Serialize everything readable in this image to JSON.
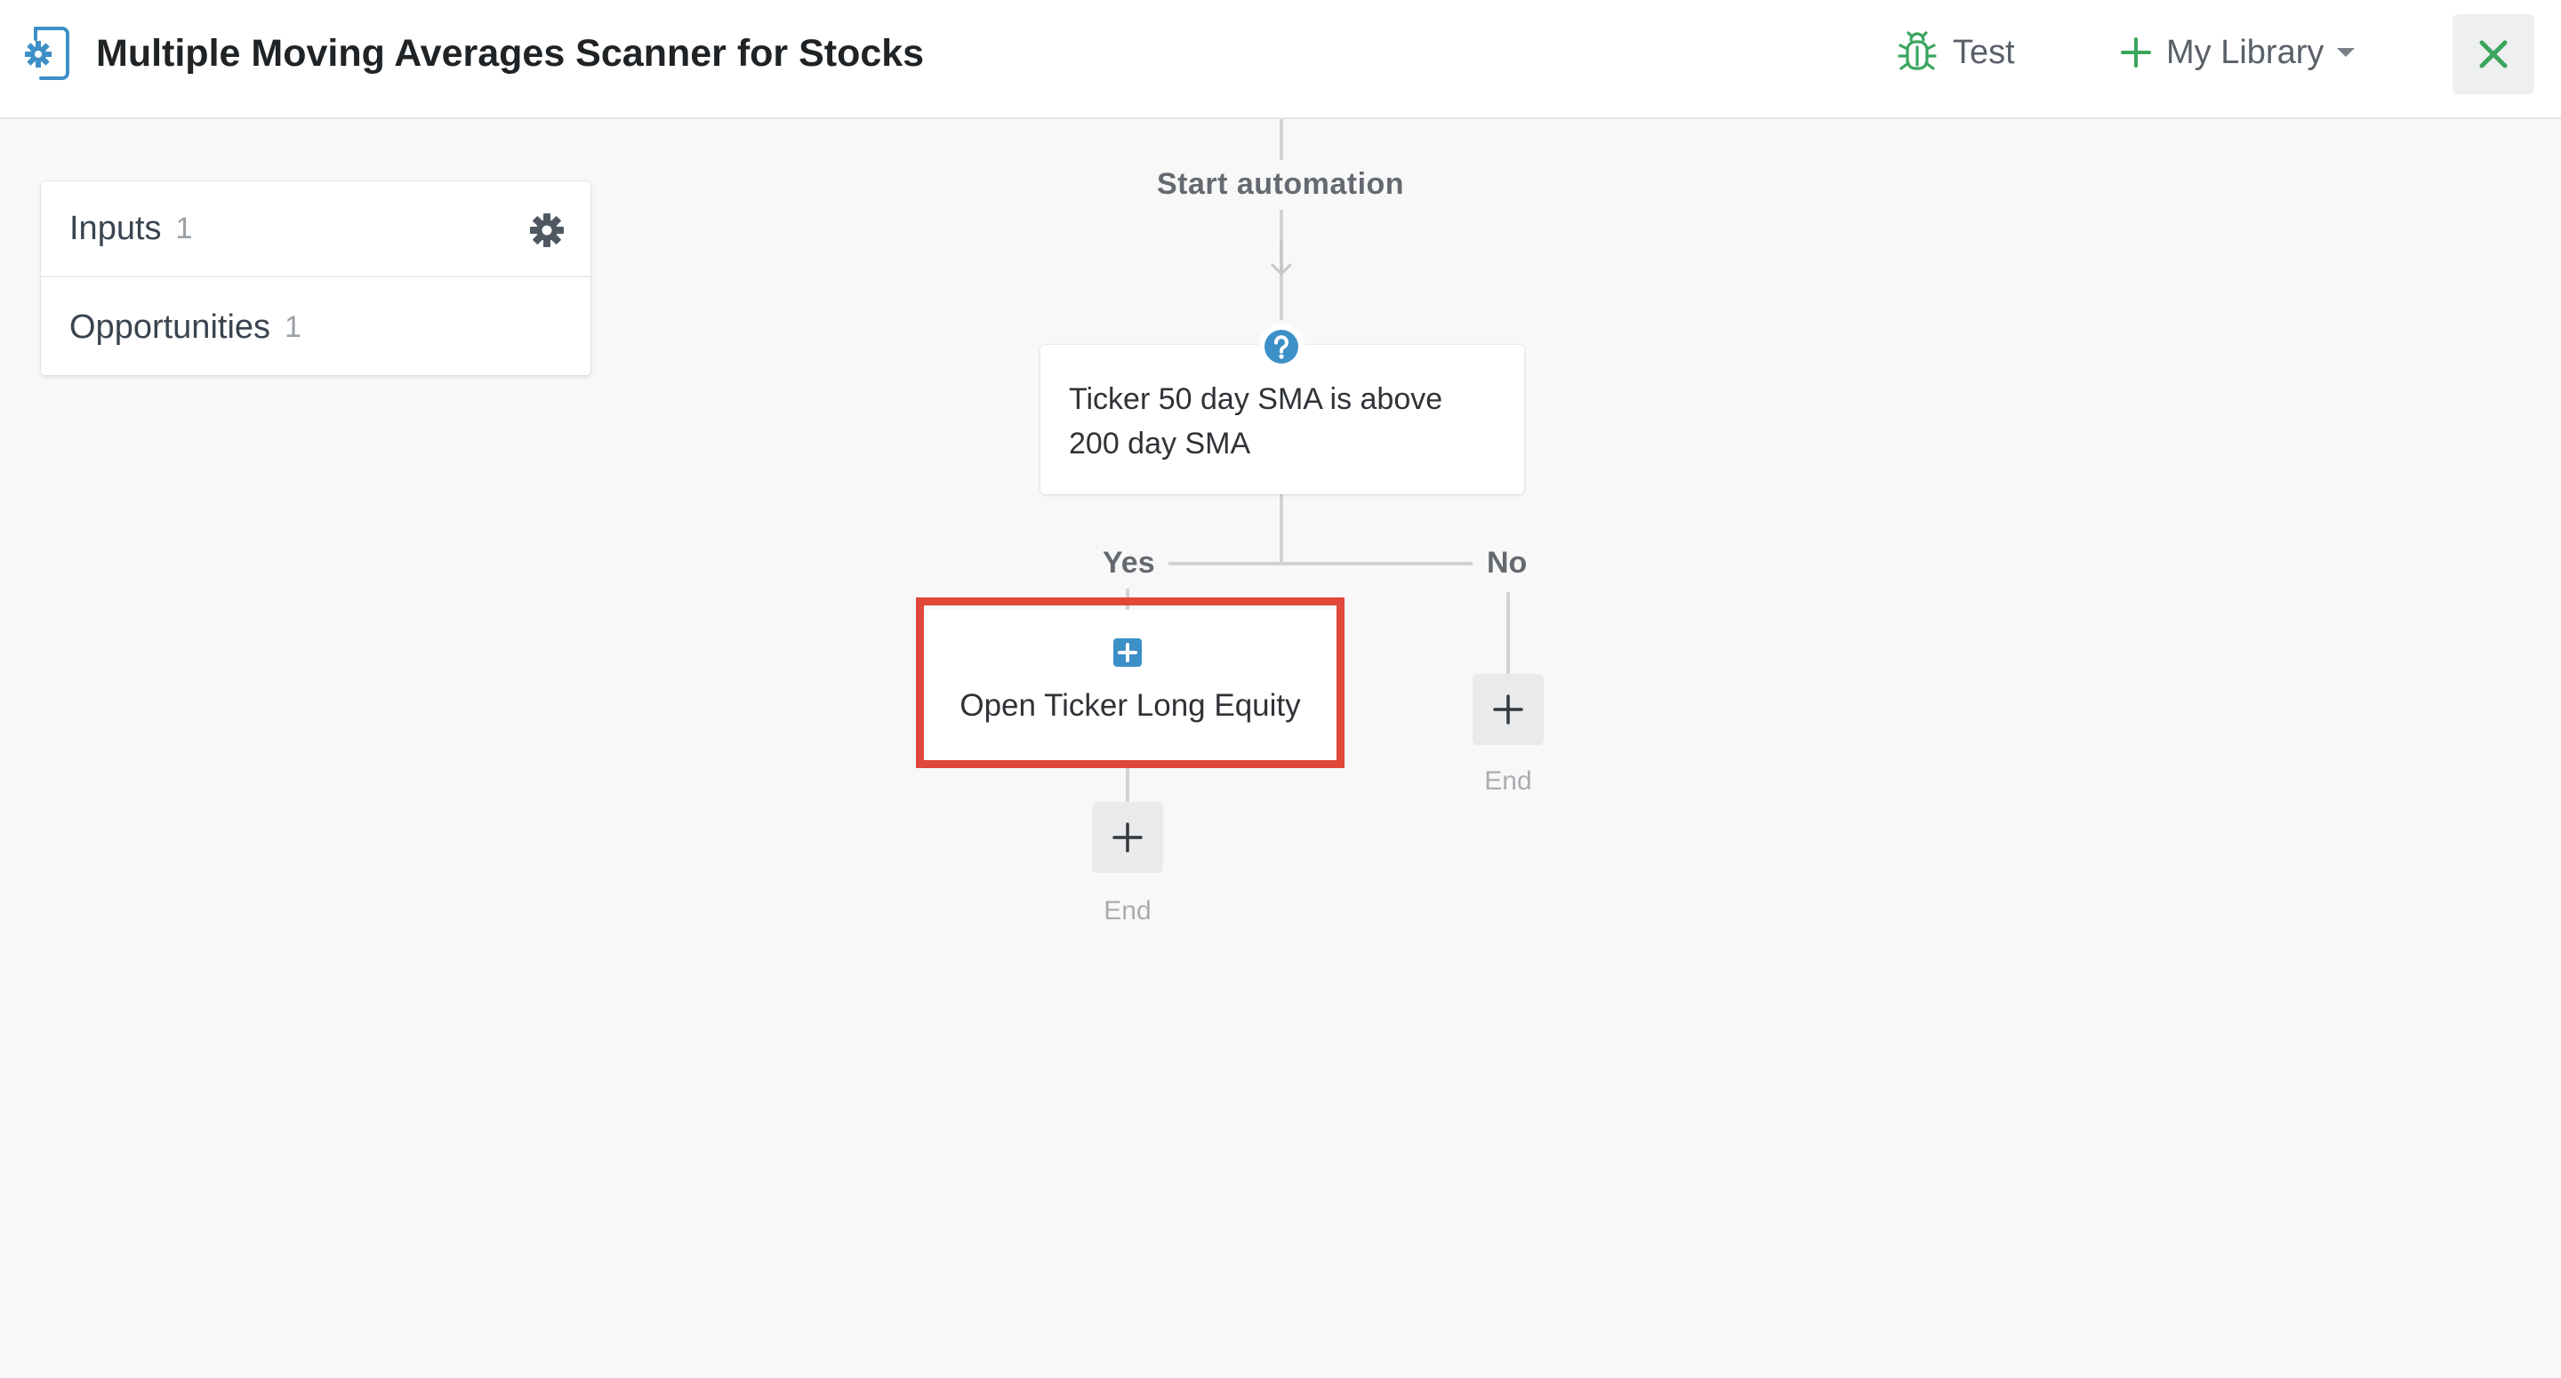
{
  "header": {
    "title": "Multiple Moving Averages Scanner for Stocks",
    "test_label": "Test",
    "library_label": "My Library",
    "accent_green": "#3aa55d",
    "icons": {
      "app": "gear-document-icon",
      "test": "bug-icon",
      "library": "plus-icon",
      "library_caret": "caret-down-icon",
      "close": "close-icon"
    }
  },
  "side_panel": {
    "items": [
      {
        "label": "Inputs",
        "count": "1",
        "icon": "gear-icon"
      },
      {
        "label": "Opportunities",
        "count": "1"
      }
    ]
  },
  "flow": {
    "start_label": "Start automation",
    "condition": {
      "text": "Ticker 50 day SMA is above 200 day SMA",
      "icon": "question-icon"
    },
    "branches": {
      "yes_label": "Yes",
      "no_label": "No"
    },
    "action": {
      "text": "Open Ticker Long Equity",
      "icon": "plus-square-icon",
      "highlight_color": "#e0483a"
    },
    "end_label_yes": "End",
    "end_label_no": "End",
    "node_icon_color": "#3d8fc7"
  }
}
